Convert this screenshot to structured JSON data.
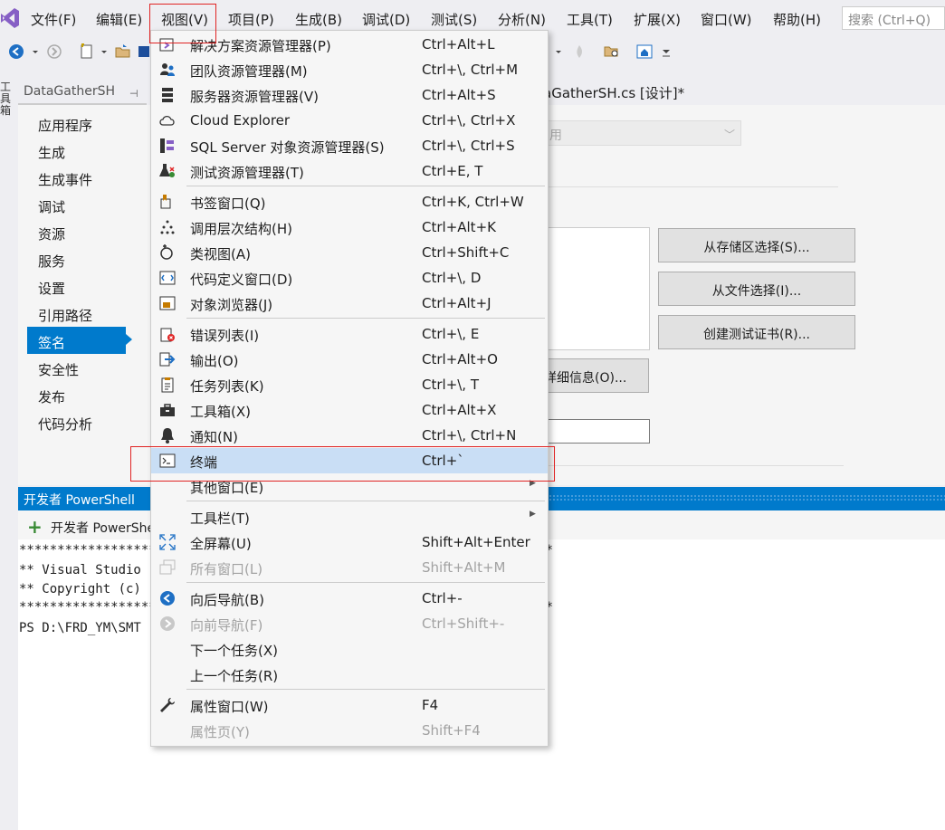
{
  "menubar": {
    "items": [
      "文件(F)",
      "编辑(E)",
      "视图(V)",
      "项目(P)",
      "生成(B)",
      "调试(D)",
      "测试(S)",
      "分析(N)",
      "工具(T)",
      "扩展(X)",
      "窗口(W)",
      "帮助(H)"
    ],
    "search_placeholder": "搜索 (Ctrl+Q)"
  },
  "project_tab": {
    "label": "DataGatherSH",
    "pin": "⊣"
  },
  "toolbox": {
    "label": "工具箱"
  },
  "doc_tab": {
    "label": "aGatherSH.cs [设计]*"
  },
  "property_nav": {
    "items": [
      "应用程序",
      "生成",
      "生成事件",
      "调试",
      "资源",
      "服务",
      "设置",
      "引用路径",
      "签名",
      "安全性",
      "发布",
      "代码分析"
    ],
    "selected_index": 8
  },
  "signing_page": {
    "combo_value": "用",
    "buttons": {
      "from_store": "从存储区选择(S)...",
      "from_file": "从文件选择(I)...",
      "create_test_cert": "创建测试证书(R)...",
      "more_details": "详细信息(O)..."
    }
  },
  "powershell": {
    "title": "开发者 PowerShell",
    "add_label": "开发者 PowerShell",
    "console_lines": [
      "**********************************************************************",
      "** Visual Studio",
      "** Copyright (c)",
      "**********************************************************************",
      "PS D:\\FRD_YM\\SMT"
    ]
  },
  "view_menu": {
    "items": [
      {
        "label": "解决方案资源管理器(P)",
        "shortcut": "Ctrl+Alt+L",
        "icon": "solution-explorer-icon"
      },
      {
        "label": "团队资源管理器(M)",
        "shortcut": "Ctrl+\\, Ctrl+M",
        "icon": "team-explorer-icon"
      },
      {
        "label": "服务器资源管理器(V)",
        "shortcut": "Ctrl+Alt+S",
        "icon": "server-explorer-icon"
      },
      {
        "label": "Cloud Explorer",
        "shortcut": "Ctrl+\\, Ctrl+X",
        "icon": "cloud-icon"
      },
      {
        "label": "SQL Server 对象资源管理器(S)",
        "shortcut": "Ctrl+\\, Ctrl+S",
        "icon": "sql-server-icon"
      },
      {
        "label": "测试资源管理器(T)",
        "shortcut": "Ctrl+E, T",
        "icon": "test-explorer-icon"
      },
      {
        "label": "书签窗口(Q)",
        "shortcut": "Ctrl+K, Ctrl+W",
        "icon": "bookmark-icon"
      },
      {
        "label": "调用层次结构(H)",
        "shortcut": "Ctrl+Alt+K",
        "icon": "call-hierarchy-icon"
      },
      {
        "label": "类视图(A)",
        "shortcut": "Ctrl+Shift+C",
        "icon": "class-view-icon"
      },
      {
        "label": "代码定义窗口(D)",
        "shortcut": "Ctrl+\\, D",
        "icon": "code-definition-icon"
      },
      {
        "label": "对象浏览器(J)",
        "shortcut": "Ctrl+Alt+J",
        "icon": "object-browser-icon"
      },
      {
        "label": "错误列表(I)",
        "shortcut": "Ctrl+\\, E",
        "icon": "error-list-icon"
      },
      {
        "label": "输出(O)",
        "shortcut": "Ctrl+Alt+O",
        "icon": "output-icon"
      },
      {
        "label": "任务列表(K)",
        "shortcut": "Ctrl+\\, T",
        "icon": "task-list-icon"
      },
      {
        "label": "工具箱(X)",
        "shortcut": "Ctrl+Alt+X",
        "icon": "toolbox-icon"
      },
      {
        "label": "通知(N)",
        "shortcut": "Ctrl+\\, Ctrl+N",
        "icon": "notification-bell-icon"
      },
      {
        "label": "终端",
        "shortcut": "Ctrl+`",
        "icon": "terminal-icon"
      },
      {
        "label": "其他窗口(E)",
        "shortcut": "",
        "icon": ""
      },
      {
        "label": "工具栏(T)",
        "shortcut": "",
        "icon": ""
      },
      {
        "label": "全屏幕(U)",
        "shortcut": "Shift+Alt+Enter",
        "icon": "fullscreen-icon"
      },
      {
        "label": "所有窗口(L)",
        "shortcut": "Shift+Alt+M",
        "icon": "all-windows-icon"
      },
      {
        "label": "向后导航(B)",
        "shortcut": "Ctrl+-",
        "icon": "navigate-back-icon"
      },
      {
        "label": "向前导航(F)",
        "shortcut": "Ctrl+Shift+-",
        "icon": "navigate-forward-icon"
      },
      {
        "label": "下一个任务(X)",
        "shortcut": "",
        "icon": ""
      },
      {
        "label": "上一个任务(R)",
        "shortcut": "",
        "icon": ""
      },
      {
        "label": "属性窗口(W)",
        "shortcut": "F4",
        "icon": "wrench-icon"
      },
      {
        "label": "属性页(Y)",
        "shortcut": "Shift+F4",
        "icon": ""
      }
    ]
  },
  "colors": {
    "accent": "#007acc",
    "highlight": "#c9def5",
    "annotation_red": "#e02424",
    "vs_purple": "#865fc5"
  }
}
